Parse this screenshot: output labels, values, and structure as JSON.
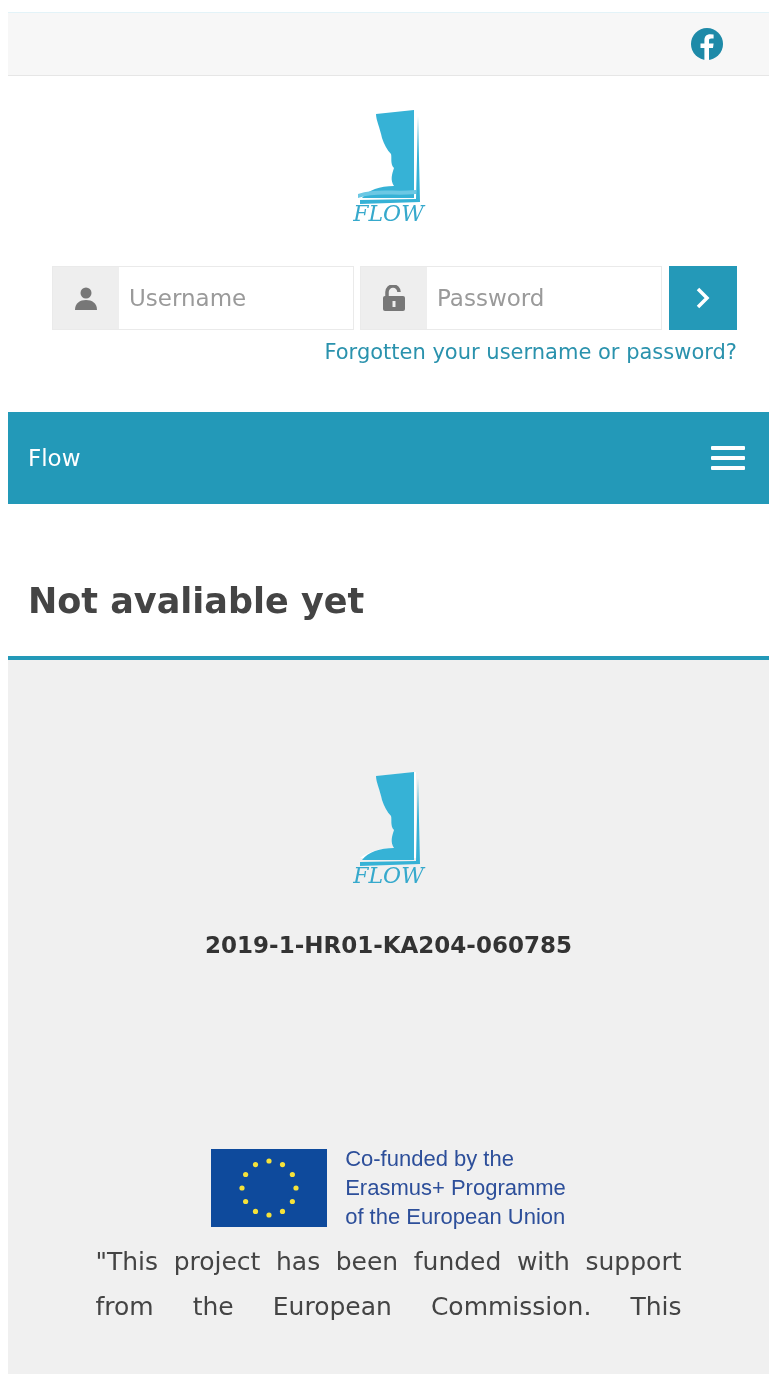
{
  "logo_text": "FLOW",
  "login": {
    "username_placeholder": "Username",
    "password_placeholder": "Password",
    "forgot_link": "Forgotten your username or password?"
  },
  "navbar": {
    "title": "Flow"
  },
  "heading": "Not avaliable yet",
  "footer": {
    "logo_text": "FLOW",
    "project_code": "2019-1-HR01-KA204-060785",
    "eu_lines": [
      "Co-funded by the",
      "Erasmus+ Programme",
      "of the European Union"
    ],
    "disclaimer": "\"This project has been funded with support from the European Commission. This"
  }
}
